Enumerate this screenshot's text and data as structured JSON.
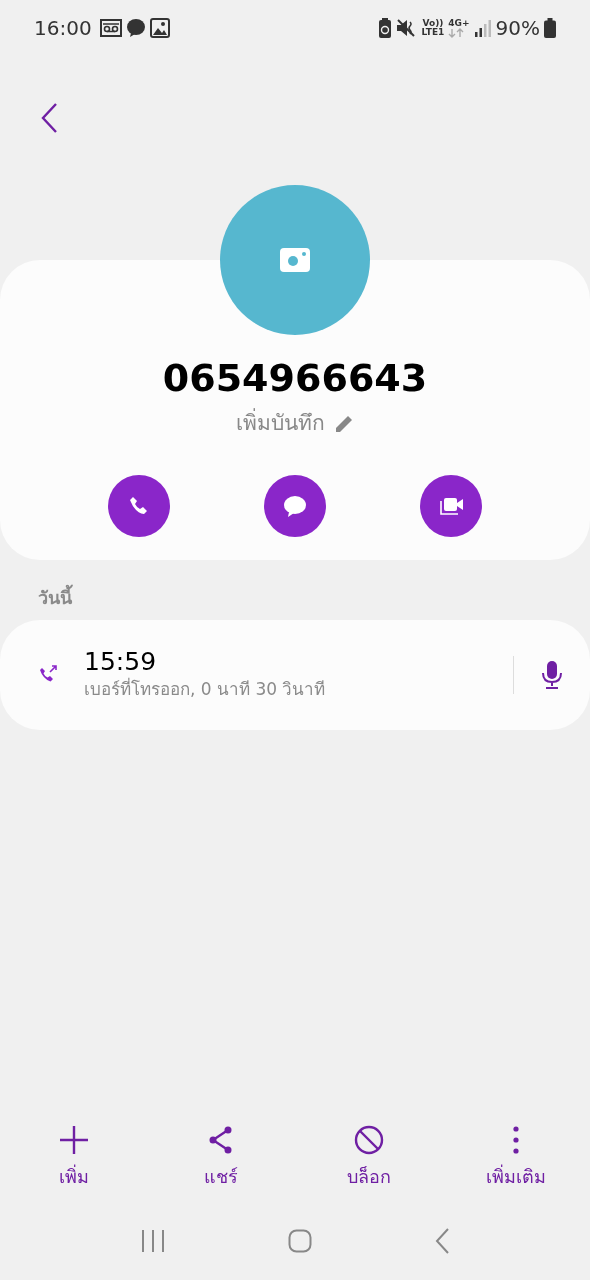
{
  "status_bar": {
    "time": "16:00",
    "volte_top": "Vo))",
    "volte_bottom": "LTE1",
    "network": "4G+",
    "battery": "90%"
  },
  "contact": {
    "number": "0654966643",
    "note_label": "เพิ่มบันทึก"
  },
  "actions": [
    {
      "kind": "call"
    },
    {
      "kind": "message"
    },
    {
      "kind": "video"
    }
  ],
  "history": {
    "heading": "วันนี้",
    "calls": [
      {
        "kind": "outgoing",
        "time": "15:59",
        "detail": "เบอร์ที่โทรออก, 0 นาที 30 วินาที"
      }
    ]
  },
  "bottom_bar": [
    {
      "kind": "add",
      "label": "เพิ่ม"
    },
    {
      "kind": "share",
      "label": "แชร์"
    },
    {
      "kind": "block",
      "label": "บล็อก"
    },
    {
      "kind": "more",
      "label": "เพิ่มเติม"
    }
  ]
}
